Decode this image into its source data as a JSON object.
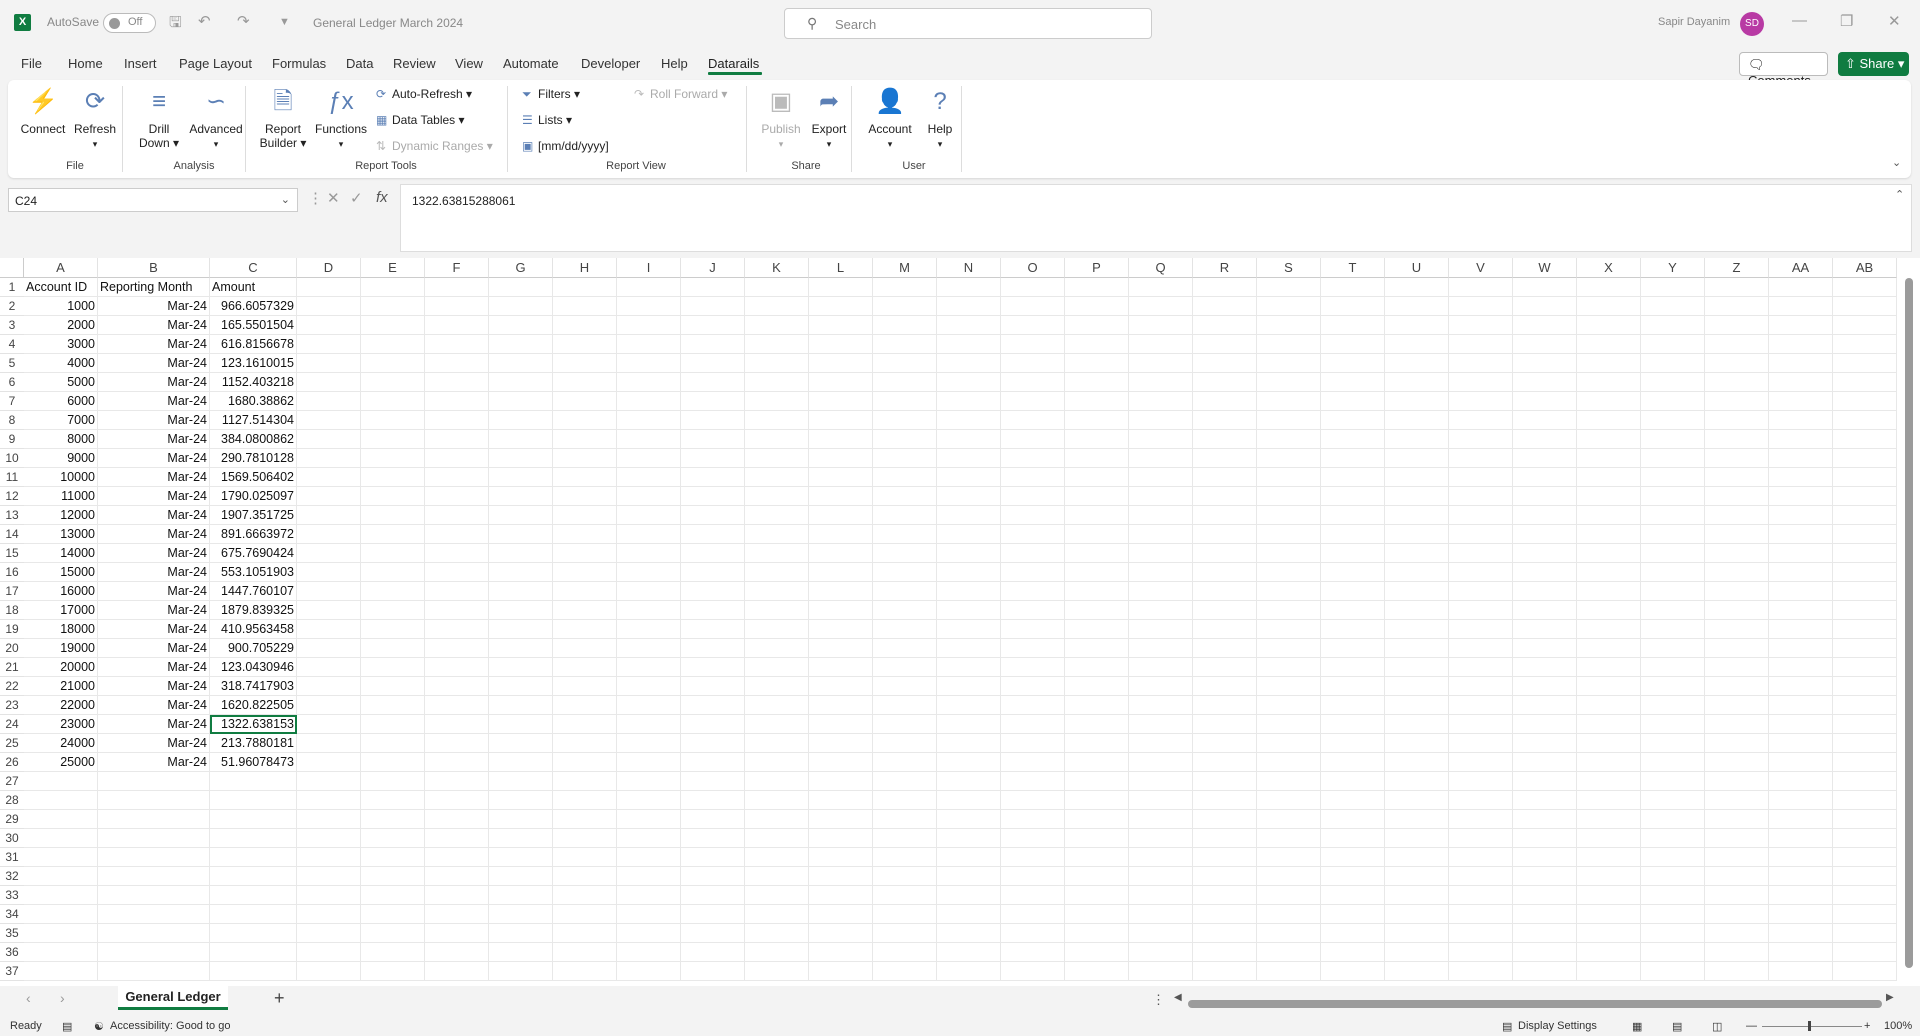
{
  "titlebar": {
    "autosave_label": "AutoSave",
    "autosave_state": "Off",
    "document_name": "General Ledger March 2024",
    "search_placeholder": "Search",
    "user_name": "Sapir Dayanim",
    "user_initials": "SD"
  },
  "menu": {
    "items": [
      "File",
      "Home",
      "Insert",
      "Page Layout",
      "Formulas",
      "Data",
      "Review",
      "View",
      "Automate",
      "Developer",
      "Help",
      "Datarails"
    ],
    "active": "Datarails",
    "comments_label": "Comments",
    "share_label": "Share"
  },
  "ribbon": {
    "file": {
      "connect": "Connect",
      "refresh": "Refresh",
      "group": "File"
    },
    "analysis": {
      "drill_down_1": "Drill",
      "drill_down_2": "Down",
      "advanced": "Advanced",
      "group": "Analysis"
    },
    "report_tools": {
      "report_builder_1": "Report",
      "report_builder_2": "Builder",
      "functions": "Functions",
      "auto_refresh": "Auto-Refresh",
      "data_tables": "Data Tables",
      "dynamic_ranges": "Dynamic Ranges",
      "group": "Report Tools"
    },
    "report_view": {
      "filters": "Filters",
      "lists": "Lists",
      "date_format": "[mm/dd/yyyy]",
      "roll_forward": "Roll Forward",
      "group": "Report View"
    },
    "share": {
      "publish": "Publish",
      "export": "Export",
      "group": "Share"
    },
    "user": {
      "account": "Account",
      "help": "Help",
      "group": "User"
    }
  },
  "formula_bar": {
    "name_box": "C24",
    "fx": "fx",
    "value": "1322.63815288061"
  },
  "columns": [
    "A",
    "B",
    "C",
    "D",
    "E",
    "F",
    "G",
    "H",
    "I",
    "J",
    "K",
    "L",
    "M",
    "N",
    "O",
    "P",
    "Q",
    "R",
    "S",
    "T",
    "U",
    "V",
    "W",
    "X",
    "Y",
    "Z",
    "AA",
    "AB"
  ],
  "rows": [
    "1",
    "2",
    "3",
    "4",
    "5",
    "6",
    "7",
    "8",
    "9",
    "10",
    "11",
    "12",
    "13",
    "14",
    "15",
    "16",
    "17",
    "18",
    "19",
    "20",
    "21",
    "22",
    "23",
    "24",
    "25",
    "26",
    "27",
    "28",
    "29",
    "30",
    "31",
    "32",
    "33",
    "34",
    "35",
    "36",
    "37"
  ],
  "table": {
    "headers": [
      "Account ID",
      "Reporting Month",
      "Amount"
    ],
    "records": [
      [
        "1000",
        "Mar-24",
        "966.6057329"
      ],
      [
        "2000",
        "Mar-24",
        "165.5501504"
      ],
      [
        "3000",
        "Mar-24",
        "616.8156678"
      ],
      [
        "4000",
        "Mar-24",
        "123.1610015"
      ],
      [
        "5000",
        "Mar-24",
        "1152.403218"
      ],
      [
        "6000",
        "Mar-24",
        "1680.38862"
      ],
      [
        "7000",
        "Mar-24",
        "1127.514304"
      ],
      [
        "8000",
        "Mar-24",
        "384.0800862"
      ],
      [
        "9000",
        "Mar-24",
        "290.7810128"
      ],
      [
        "10000",
        "Mar-24",
        "1569.506402"
      ],
      [
        "11000",
        "Mar-24",
        "1790.025097"
      ],
      [
        "12000",
        "Mar-24",
        "1907.351725"
      ],
      [
        "13000",
        "Mar-24",
        "891.6663972"
      ],
      [
        "14000",
        "Mar-24",
        "675.7690424"
      ],
      [
        "15000",
        "Mar-24",
        "553.1051903"
      ],
      [
        "16000",
        "Mar-24",
        "1447.760107"
      ],
      [
        "17000",
        "Mar-24",
        "1879.839325"
      ],
      [
        "18000",
        "Mar-24",
        "410.9563458"
      ],
      [
        "19000",
        "Mar-24",
        "900.705229"
      ],
      [
        "20000",
        "Mar-24",
        "123.0430946"
      ],
      [
        "21000",
        "Mar-24",
        "318.7417903"
      ],
      [
        "22000",
        "Mar-24",
        "1620.822505"
      ],
      [
        "23000",
        "Mar-24",
        "1322.638153"
      ],
      [
        "24000",
        "Mar-24",
        "213.7880181"
      ],
      [
        "25000",
        "Mar-24",
        "51.96078473"
      ]
    ]
  },
  "sheets": {
    "active": "General Ledger"
  },
  "status": {
    "ready": "Ready",
    "accessibility": "Accessibility: Good to go",
    "display_settings": "Display Settings",
    "zoom": "100%"
  },
  "colors": {
    "accent": "#107c41",
    "avatar": "#b83aa4"
  }
}
